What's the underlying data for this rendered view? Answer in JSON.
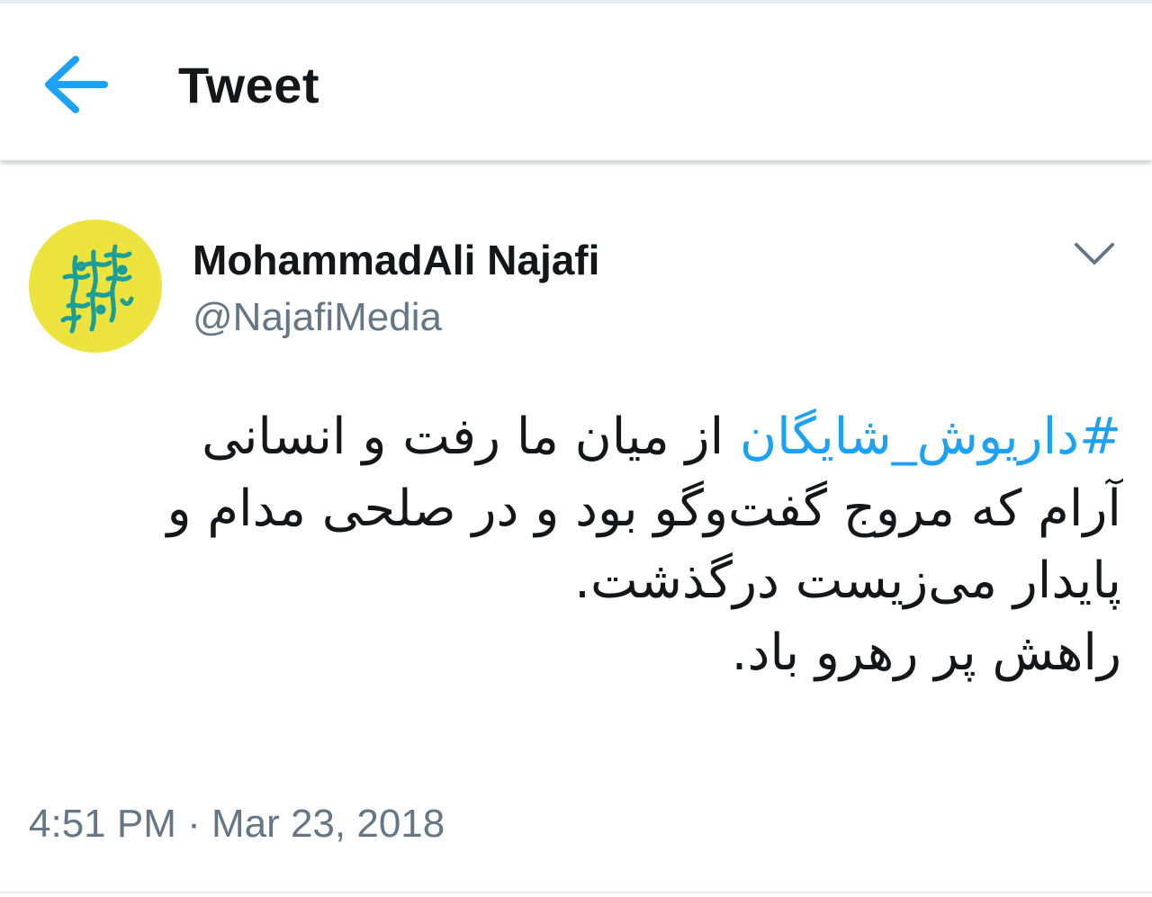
{
  "header": {
    "back_icon": "arrow-left-icon",
    "title": "Tweet"
  },
  "tweet": {
    "author": {
      "name": "MohammadAli Najafi",
      "handle": "@NajafiMedia",
      "avatar_color": "#ece33f",
      "avatar_art_color": "#1a9e97"
    },
    "menu_icon": "chevron-down-icon",
    "text": {
      "hashtag": "#داریوش_شایگان",
      "line1_rest": " از میان ما رفت و انسانی",
      "line2": "آرام که مروج گفت‌وگو بود و در صلحی مدام و",
      "line3": "پایدار می‌زیست درگذشت.",
      "line4": "راهش پر رهرو باد."
    },
    "timestamp": "4:51 PM · Mar 23, 2018"
  },
  "colors": {
    "accent": "#1da1f2",
    "secondary_text": "#657786",
    "primary_text": "#14171a"
  }
}
